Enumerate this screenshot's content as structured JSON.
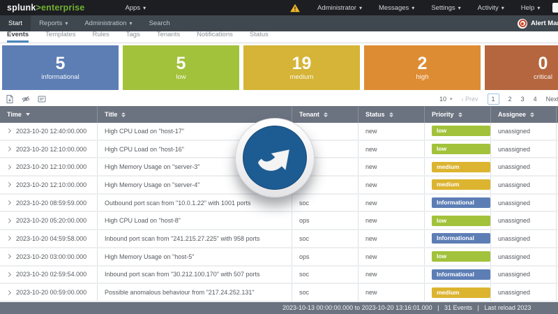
{
  "topbar": {
    "brand": {
      "word1": "splunk",
      "gt": ">",
      "word2": "enterprise"
    },
    "apps_label": "Apps",
    "menus": [
      {
        "label": "Administrator"
      },
      {
        "label": "Messages"
      },
      {
        "label": "Settings"
      },
      {
        "label": "Activity"
      },
      {
        "label": "Help"
      }
    ]
  },
  "appbar": {
    "items": [
      {
        "label": "Start",
        "active": true
      },
      {
        "label": "Reports"
      },
      {
        "label": "Administration"
      },
      {
        "label": "Search"
      }
    ],
    "app_name": "Alert Manager"
  },
  "tabs": [
    {
      "label": "Events",
      "active": true
    },
    {
      "label": "Templates"
    },
    {
      "label": "Rules"
    },
    {
      "label": "Tags"
    },
    {
      "label": "Tenants"
    },
    {
      "label": "Notifications"
    },
    {
      "label": "Status"
    }
  ],
  "cards": [
    {
      "count": "5",
      "label": "informational",
      "color": "#5d7eb5"
    },
    {
      "count": "5",
      "label": "low",
      "color": "#a2c23b"
    },
    {
      "count": "19",
      "label": "medium",
      "color": "#d5b437"
    },
    {
      "count": "2",
      "label": "high",
      "color": "#de8c33"
    },
    {
      "count": "0",
      "label": "critical",
      "color": "#b5663e"
    }
  ],
  "toolbar": {
    "icons": [
      "export-icon",
      "eye-off-icon",
      "notes-icon"
    ],
    "page_size": "10",
    "prev_label": "‹ Prev",
    "pages": [
      "1",
      "2",
      "3",
      "4"
    ],
    "current_page": "1",
    "next_label": "Next"
  },
  "table": {
    "headers": [
      "Time",
      "Title",
      "Tenant",
      "Status",
      "Priority",
      "Assignee"
    ],
    "rows": [
      {
        "time": "2023-10-20 12:40:00.000",
        "title": "High CPU Load on \"host-17\"",
        "tenant": "",
        "status": "new",
        "priority": "low",
        "priority_color": "#a2c23b",
        "assignee": "unassigned"
      },
      {
        "time": "2023-10-20 12:10:00.000",
        "title": "High CPU Load on \"host-16\"",
        "tenant": "",
        "status": "new",
        "priority": "low",
        "priority_color": "#a2c23b",
        "assignee": "unassigned"
      },
      {
        "time": "2023-10-20 12:10:00.000",
        "title": "High Memory Usage on \"server-3\"",
        "tenant": "",
        "status": "new",
        "priority": "medium",
        "priority_color": "#dcb430",
        "assignee": "unassigned"
      },
      {
        "time": "2023-10-20 12:10:00.000",
        "title": "High Memory Usage on \"server-4\"",
        "tenant": "",
        "status": "new",
        "priority": "medium",
        "priority_color": "#dcb430",
        "assignee": "unassigned"
      },
      {
        "time": "2023-10-20 08:59:59.000",
        "title": "Outbound port scan from \"10.0.1.22\" with 1001 ports",
        "tenant": "soc",
        "status": "new",
        "priority": "Informational",
        "priority_color": "#5d7eb5",
        "assignee": "unassigned"
      },
      {
        "time": "2023-10-20 05:20:00.000",
        "title": "High CPU Load on \"host-8\"",
        "tenant": "ops",
        "status": "new",
        "priority": "low",
        "priority_color": "#a2c23b",
        "assignee": "unassigned"
      },
      {
        "time": "2023-10-20 04:59:58.000",
        "title": "Inbound port scan from \"241.215.27.225\" with 958 ports",
        "tenant": "soc",
        "status": "new",
        "priority": "Informational",
        "priority_color": "#5d7eb5",
        "assignee": "unassigned"
      },
      {
        "time": "2023-10-20 03:00:00.000",
        "title": "High Memory Usage on \"host-5\"",
        "tenant": "ops",
        "status": "new",
        "priority": "low",
        "priority_color": "#a2c23b",
        "assignee": "unassigned"
      },
      {
        "time": "2023-10-20 02:59:54.000",
        "title": "Inbound port scan from \"30.212.100.170\" with 507 ports",
        "tenant": "soc",
        "status": "new",
        "priority": "Informational",
        "priority_color": "#5d7eb5",
        "assignee": "unassigned"
      },
      {
        "time": "2023-10-20 00:59:00.000",
        "title": "Possible anomalous behaviour from \"217.24.252.131\"",
        "tenant": "soc",
        "status": "new",
        "priority": "medium",
        "priority_color": "#dcb430",
        "assignee": "unassigned"
      }
    ]
  },
  "footer": {
    "text": "2023-10-13 00:00:00.000 to 2023-10-20 13:16:01.000   |   31 Events   |   Last reload 2023"
  }
}
